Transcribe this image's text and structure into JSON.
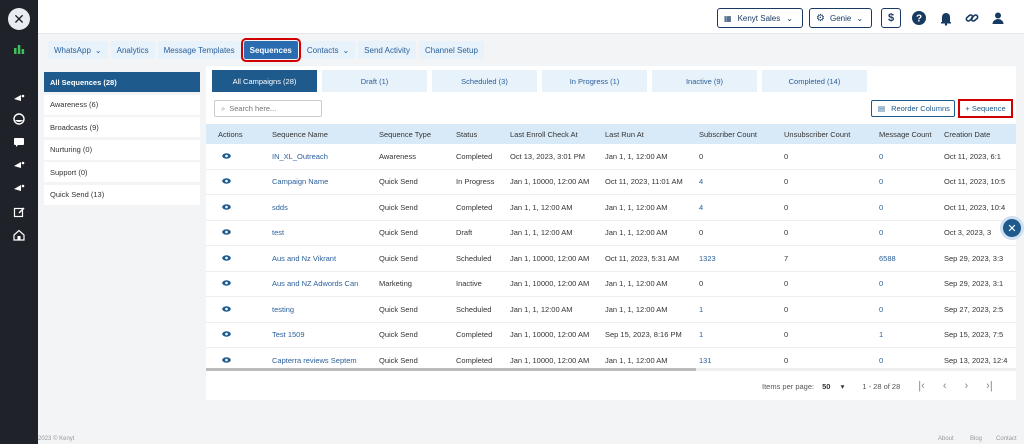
{
  "header": {
    "account": "Kenyt Sales",
    "genie": "Genie"
  },
  "nav_tabs": [
    "WhatsApp",
    "Analytics",
    "Message Templates",
    "Sequences",
    "Contacts",
    "Send Activity",
    "Channel Setup"
  ],
  "categories": [
    "All Sequences (28)",
    "Awareness (6)",
    "Broadcasts (9)",
    "Nurturing (0)",
    "Support (0)",
    "Quick Send (13)"
  ],
  "campaign_tabs": [
    "All Campaigns (28)",
    "Draft (1)",
    "Scheduled (3)",
    "In Progress (1)",
    "Inactive (9)",
    "Completed (14)"
  ],
  "search": {
    "placeholder": "Search here..."
  },
  "buttons": {
    "reorder": "Reorder Columns",
    "add_sequence": "+ Sequence"
  },
  "table": {
    "columns": [
      "Actions",
      "Sequence Name",
      "Sequence Type",
      "Status",
      "Last Enroll Check At",
      "Last Run At",
      "Subscriber Count",
      "Unsubscriber Count",
      "Message Count",
      "Creation Date"
    ],
    "rows": [
      [
        "IN_XL_Outreach",
        "Awareness",
        "Completed",
        "Oct 13, 2023, 3:01 PM",
        "Jan 1, 1, 12:00 AM",
        "0",
        "0",
        "0",
        "Oct 11, 2023, 6:1"
      ],
      [
        "Campaign Name",
        "Quick Send",
        "In Progress",
        "Jan 1, 10000, 12:00 AM",
        "Oct 11, 2023, 11:01 AM",
        "4",
        "0",
        "0",
        "Oct 11, 2023, 10:5"
      ],
      [
        "sdds",
        "Quick Send",
        "Completed",
        "Jan 1, 1, 12:00 AM",
        "Jan 1, 1, 12:00 AM",
        "4",
        "0",
        "0",
        "Oct 11, 2023, 10:4"
      ],
      [
        "test",
        "Quick Send",
        "Draft",
        "Jan 1, 1, 12:00 AM",
        "Jan 1, 1, 12:00 AM",
        "0",
        "0",
        "0",
        "Oct 3, 2023, 3"
      ],
      [
        "Aus and Nz Vikrant",
        "Quick Send",
        "Scheduled",
        "Jan 1, 10000, 12:00 AM",
        "Oct 11, 2023, 5:31 AM",
        "1323",
        "7",
        "6588",
        "Sep 29, 2023, 3:3"
      ],
      [
        "Aus and NZ Adwords Can",
        "Marketing",
        "Inactive",
        "Jan 1, 10000, 12:00 AM",
        "Jan 1, 1, 12:00 AM",
        "0",
        "0",
        "0",
        "Sep 29, 2023, 3:1"
      ],
      [
        "testing",
        "Quick Send",
        "Scheduled",
        "Jan 1, 1, 12:00 AM",
        "Jan 1, 1, 12:00 AM",
        "1",
        "0",
        "0",
        "Sep 27, 2023, 2:5"
      ],
      [
        "Test 1509",
        "Quick Send",
        "Completed",
        "Jan 1, 10000, 12:00 AM",
        "Sep 15, 2023, 8:16 PM",
        "1",
        "0",
        "1",
        "Sep 15, 2023, 7:5"
      ],
      [
        "Capterra reviews Septem",
        "Quick Send",
        "Completed",
        "Jan 1, 10000, 12:00 AM",
        "Jan 1, 1, 12:00 AM",
        "131",
        "0",
        "0",
        "Sep 13, 2023, 12:4"
      ]
    ]
  },
  "pagination": {
    "label": "Items per page:",
    "per_page": "50",
    "range": "1 - 28 of 28"
  },
  "footer": {
    "copyright": "2023 © Kenyt",
    "links": [
      "About",
      "Blog",
      "Contact"
    ]
  }
}
